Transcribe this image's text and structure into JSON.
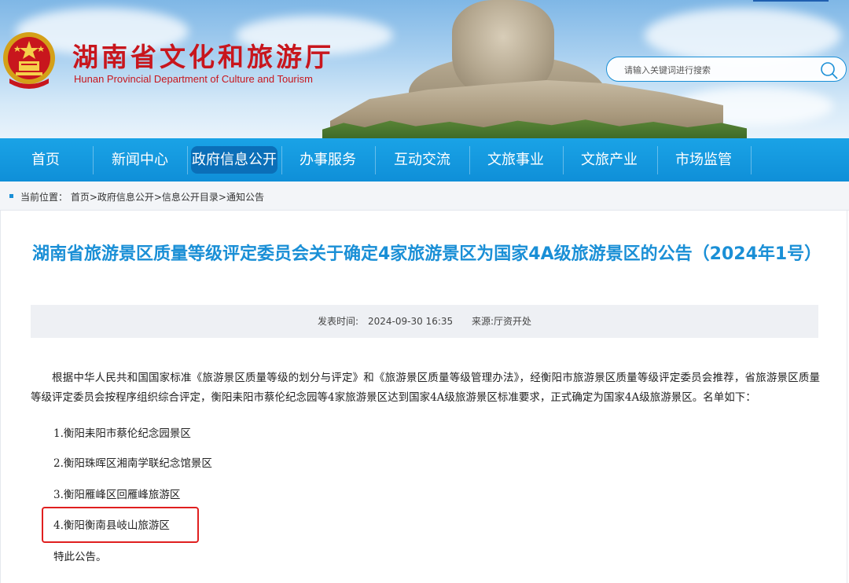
{
  "header": {
    "title": "湖南省文化和旅游厅",
    "subtitle": "Hunan Provincial Department of Culture and Tourism",
    "search_placeholder": "请输入关键词进行搜索"
  },
  "nav": {
    "items": [
      {
        "label": "首页",
        "active": false
      },
      {
        "label": "新闻中心",
        "active": false
      },
      {
        "label": "政府信息公开",
        "active": true
      },
      {
        "label": "办事服务",
        "active": false
      },
      {
        "label": "互动交流",
        "active": false
      },
      {
        "label": "文旅事业",
        "active": false
      },
      {
        "label": "文旅产业",
        "active": false
      },
      {
        "label": "市场监管",
        "active": false
      }
    ]
  },
  "breadcrumb": {
    "text": "当前位置：  首页>政府信息公开>信息公开目录>通知公告"
  },
  "article": {
    "title": "湖南省旅游景区质量等级评定委员会关于确定4家旅游景区为国家4A级旅游景区的公告（2024年1号）",
    "meta": {
      "date_label": "发表时间:",
      "date": "2024-09-30 16:35",
      "source_label": "来源:",
      "source": "厅资开处"
    },
    "intro": "根据中华人民共和国国家标准《旅游景区质量等级的划分与评定》和《旅游景区质量等级管理办法》，经衡阳市旅游景区质量等级评定委员会推荐，省旅游景区质量等级评定委员会按程序组织综合评定，衡阳耒阳市蔡伦纪念园等4家旅游景区达到国家4A级旅游景区标准要求，正式确定为国家4A级旅游景区。名单如下：",
    "list": [
      "1.衡阳耒阳市蔡伦纪念园景区",
      "2.衡阳珠晖区湘南学联纪念馆景区",
      "3.衡阳雁峰区回雁峰旅游区",
      "4.衡阳衡南县岐山旅游区"
    ],
    "closing": "特此公告。"
  },
  "colors": {
    "brand_red": "#c8161d",
    "nav_blue": "#1aa3e6",
    "title_blue": "#1a8fd6",
    "highlight_red": "#e02020"
  }
}
